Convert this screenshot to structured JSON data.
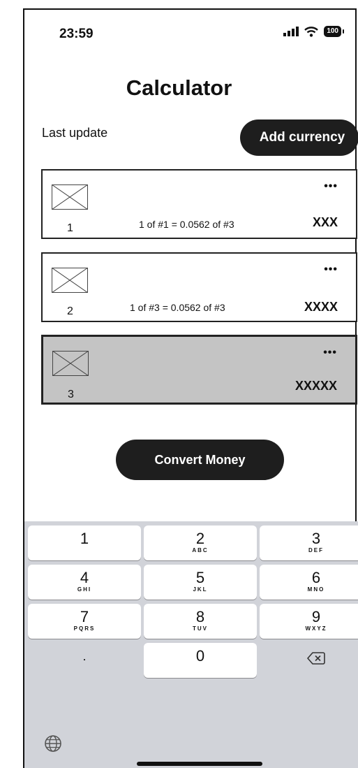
{
  "status_bar": {
    "time": "23:59",
    "battery": "100"
  },
  "header": {
    "title": "Calculator"
  },
  "toolbar": {
    "last_update_label": "Last update",
    "add_currency_label": "Add currency"
  },
  "currencies": [
    {
      "number": "1",
      "rate_text": "1 of #1 = 0.0562 of #3",
      "code": "XXX",
      "more": "•••",
      "selected": false
    },
    {
      "number": "2",
      "rate_text": "1 of #3 = 0.0562 of #3",
      "code": "XXXX",
      "more": "•••",
      "selected": false
    },
    {
      "number": "3",
      "rate_text": "",
      "code": "XXXXX",
      "more": "•••",
      "selected": true
    }
  ],
  "actions": {
    "convert_label": "Convert Money"
  },
  "keypad": {
    "keys": [
      {
        "digit": "1",
        "letters": ""
      },
      {
        "digit": "2",
        "letters": "ABC"
      },
      {
        "digit": "3",
        "letters": "DEF"
      },
      {
        "digit": "4",
        "letters": "GHI"
      },
      {
        "digit": "5",
        "letters": "JKL"
      },
      {
        "digit": "6",
        "letters": "MNO"
      },
      {
        "digit": "7",
        "letters": "PQRS"
      },
      {
        "digit": "8",
        "letters": "TUV"
      },
      {
        "digit": "9",
        "letters": "WXYZ"
      },
      {
        "digit": ".",
        "letters": ""
      },
      {
        "digit": "0",
        "letters": ""
      }
    ],
    "icons": {
      "delete": "backspace-icon",
      "globe": "globe-icon"
    }
  }
}
